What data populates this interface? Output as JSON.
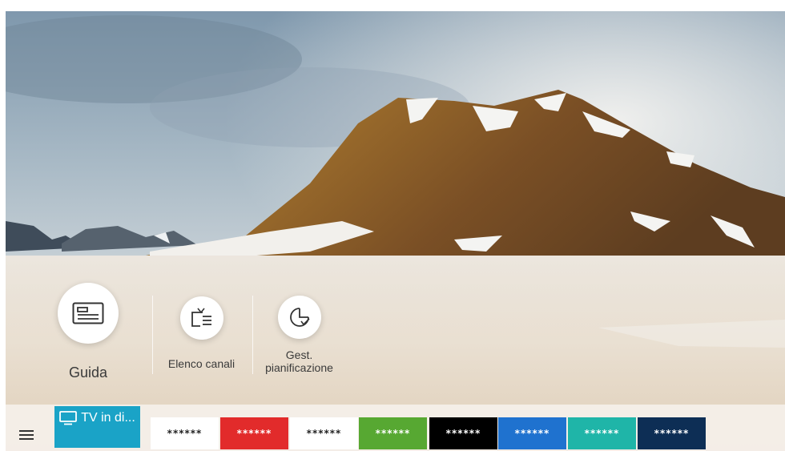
{
  "shortcuts": [
    {
      "label": "Guida",
      "icon": "guide-icon"
    },
    {
      "label": "Elenco canali",
      "icon": "channel-list-icon"
    },
    {
      "label": "Gest. pianificazione",
      "label_lines": [
        "Gest.",
        "pianificazione"
      ],
      "icon": "schedule-icon"
    }
  ],
  "bottom_bar": {
    "menu_icon": "hamburger-menu-icon",
    "live_tv": {
      "label": "TV in di...",
      "icon": "tv-icon",
      "color": "#1aa3c7"
    },
    "apps": [
      {
        "label": "******",
        "bg": "#ffffff",
        "fg": "#222222"
      },
      {
        "label": "******",
        "bg": "#e22b2b",
        "fg": "#ffffff"
      },
      {
        "label": "******",
        "bg": "#ffffff",
        "fg": "#222222"
      },
      {
        "label": "******",
        "bg": "#57a832",
        "fg": "#ffffff"
      },
      {
        "label": "******",
        "bg": "#000000",
        "fg": "#ffffff"
      },
      {
        "label": "******",
        "bg": "#1f72cf",
        "fg": "#ffffff"
      },
      {
        "label": "******",
        "bg": "#1fb5a8",
        "fg": "#ffffff"
      },
      {
        "label": "******",
        "bg": "#0d2e55",
        "fg": "#ffffff"
      }
    ]
  }
}
